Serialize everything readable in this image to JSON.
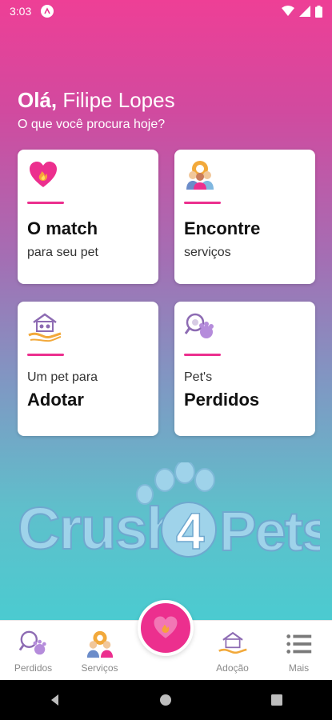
{
  "status_bar": {
    "time": "3:03"
  },
  "greeting": {
    "hello": "Olá,",
    "name": "Filipe Lopes",
    "question": "O que você procura hoje?"
  },
  "cards": [
    {
      "title": "O match",
      "subtitle": "para seu pet",
      "icon": "heart-fire-icon"
    },
    {
      "title": "Encontre",
      "subtitle": "serviços",
      "icon": "people-gear-icon"
    },
    {
      "title": "Adotar",
      "subtitle": "Um pet para",
      "icon": "house-hand-icon"
    },
    {
      "title": "Perdidos",
      "subtitle": "Pet's",
      "icon": "magnifier-paw-icon"
    }
  ],
  "logo": {
    "text": "Crush 4 Pets"
  },
  "nav": [
    {
      "label": "Perdidos"
    },
    {
      "label": "Serviços"
    },
    {
      "label": ""
    },
    {
      "label": "Adoção"
    },
    {
      "label": "Mais"
    }
  ],
  "colors": {
    "brand_pink": "#ec2f8e",
    "gradient_top": "#ee3f96",
    "gradient_bottom": "#4bcbd0",
    "logo_blue": "#9fd3ea"
  }
}
